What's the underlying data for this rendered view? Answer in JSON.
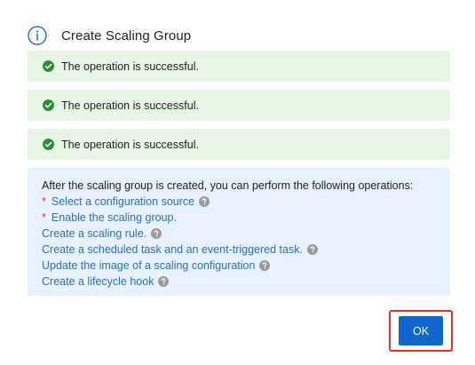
{
  "dialog": {
    "title": "Create Scaling Group",
    "icon": "info-icon"
  },
  "messages": [
    {
      "icon": "check-circle-icon",
      "text": "The operation is successful."
    },
    {
      "icon": "check-circle-icon",
      "text": "The operation is successful."
    },
    {
      "icon": "check-circle-icon",
      "text": "The operation is successful."
    }
  ],
  "next_steps": {
    "intro": "After the scaling group is created, you can perform the following operations:",
    "items": [
      {
        "required_mark": "*",
        "label": "Select a configuration source",
        "help_icon": true
      },
      {
        "required_mark": "*",
        "label": "Enable the scaling group.",
        "help_icon": false
      },
      {
        "required_mark": "",
        "label": "Create a scaling rule.",
        "help_icon": true
      },
      {
        "required_mark": "",
        "label": "Create a scheduled task and an event-triggered task.",
        "help_icon": true
      },
      {
        "required_mark": "",
        "label": "Update the image of a scaling configuration",
        "help_icon": true
      },
      {
        "required_mark": "",
        "label": "Create a lifecycle hook",
        "help_icon": true
      }
    ]
  },
  "footer": {
    "ok_label": "OK"
  },
  "colors": {
    "primary": "#1166cc",
    "link": "#2a6fb7",
    "success_bg": "#e7f5e4",
    "success_icon": "#2e8b3e",
    "info_bg": "#e8f2fe",
    "required": "#e0301e",
    "highlight": "#e0302a"
  }
}
